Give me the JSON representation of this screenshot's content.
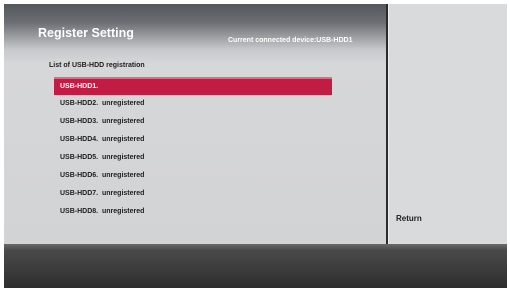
{
  "header": {
    "title": "Register Setting",
    "device_info": "Current connected device:USB-HDD1"
  },
  "list": {
    "heading": "List of USB-HDD registration",
    "selected_index": 0,
    "items": [
      {
        "label": "USB-HDD1."
      },
      {
        "label": "USB-HDD2.  unregistered"
      },
      {
        "label": "USB-HDD3.  unregistered"
      },
      {
        "label": "USB-HDD4.  unregistered"
      },
      {
        "label": "USB-HDD5.  unregistered"
      },
      {
        "label": "USB-HDD6.  unregistered"
      },
      {
        "label": "USB-HDD7.  unregistered"
      },
      {
        "label": "USB-HDD8.  unregistered"
      }
    ]
  },
  "side": {
    "return_label": "Return"
  },
  "colors": {
    "selection": "#c31c44",
    "panel": "#d2d3d5",
    "bottom_bar": "#2e2e2e"
  }
}
